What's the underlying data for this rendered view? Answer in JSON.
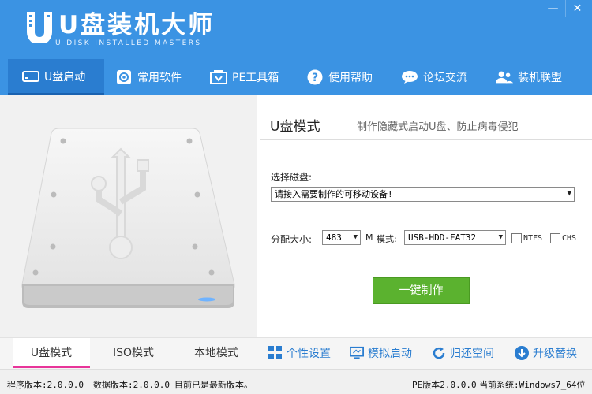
{
  "app": {
    "title": "U盘装机大师",
    "subtitle": "U DISK INSTALLED MASTERS",
    "minimize_glyph": "—",
    "close_glyph": "✕"
  },
  "nav": [
    {
      "label": "U盘启动",
      "icon": "usb-drive-icon",
      "active": true
    },
    {
      "label": "常用软件",
      "icon": "software-icon",
      "active": false
    },
    {
      "label": "PE工具箱",
      "icon": "toolbox-icon",
      "active": false
    },
    {
      "label": "使用帮助",
      "icon": "help-icon",
      "active": false
    },
    {
      "label": "论坛交流",
      "icon": "forum-icon",
      "active": false
    },
    {
      "label": "装机联盟",
      "icon": "users-icon",
      "active": false
    }
  ],
  "mode": {
    "title": "U盘模式",
    "description": "制作隐藏式启动U盘、防止病毒侵犯"
  },
  "disk": {
    "label": "选择磁盘:",
    "value": "请接入需要制作的可移动设备!"
  },
  "partition": {
    "label": "分配大小:",
    "size": "483",
    "unit": "M",
    "mode_label": "模式:",
    "mode_value": "USB-HDD-FAT32",
    "ntfs_label": "NTFS",
    "chs_label": "CHS"
  },
  "make_button": "一键制作",
  "tabs": [
    {
      "label": "U盘模式",
      "active": true
    },
    {
      "label": "ISO模式",
      "active": false
    },
    {
      "label": "本地模式",
      "active": false
    }
  ],
  "actions": [
    {
      "label": "个性设置",
      "icon": "grid-icon"
    },
    {
      "label": "模拟启动",
      "icon": "monitor-icon"
    },
    {
      "label": "归还空间",
      "icon": "refresh-icon"
    },
    {
      "label": "升级替换",
      "icon": "download-icon"
    }
  ],
  "status": {
    "program_version": "程序版本:2.0.0.0",
    "data_version": "数据版本:2.0.0.0",
    "latest_note": "目前已是最新版本。",
    "pe_version": "PE版本2.0.0.0",
    "current_system": "当前系统:Windows7_64位"
  },
  "colors": {
    "header_blue": "#3b93e3",
    "active_nav": "#2a7dd0",
    "make_green": "#5bb22f",
    "tab_accent": "#e8359a",
    "action_blue": "#2a7dd0"
  }
}
